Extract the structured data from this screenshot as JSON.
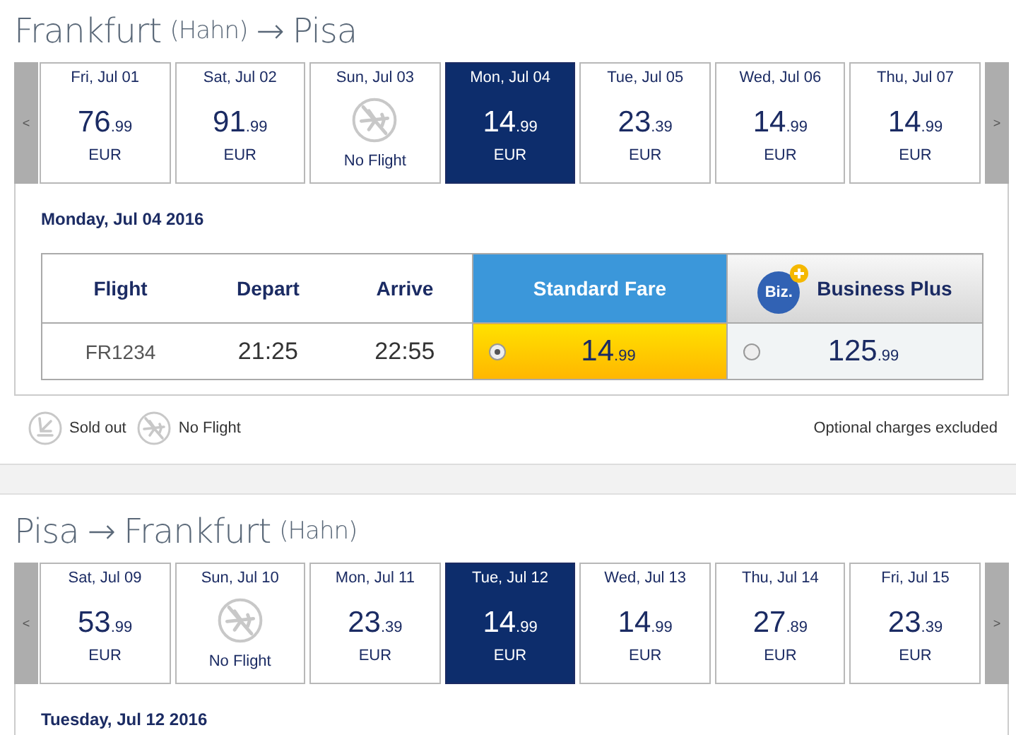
{
  "sections": [
    {
      "route": [
        {
          "text": "Frankfurt",
          "kind": "city"
        },
        {
          "text": "(Hahn)",
          "kind": "note"
        },
        {
          "text": "→",
          "kind": "city"
        },
        {
          "text": "Pisa",
          "kind": "city"
        }
      ],
      "prev": "<",
      "next": ">",
      "days": [
        {
          "day": "Fri, Jul 01",
          "kind": "fare",
          "price": "76",
          "cents": ".99",
          "currency": "EUR",
          "selected": false
        },
        {
          "day": "Sat, Jul 02",
          "kind": "fare",
          "price": "91",
          "cents": ".99",
          "currency": "EUR",
          "selected": false
        },
        {
          "day": "Sun, Jul 03",
          "kind": "no_flight",
          "label": "No Flight",
          "selected": false
        },
        {
          "day": "Mon, Jul 04",
          "kind": "fare",
          "price": "14",
          "cents": ".99",
          "currency": "EUR",
          "selected": true
        },
        {
          "day": "Tue, Jul 05",
          "kind": "fare",
          "price": "23",
          "cents": ".39",
          "currency": "EUR",
          "selected": false
        },
        {
          "day": "Wed, Jul 06",
          "kind": "fare",
          "price": "14",
          "cents": ".99",
          "currency": "EUR",
          "selected": false
        },
        {
          "day": "Thu, Jul 07",
          "kind": "fare",
          "price": "14",
          "cents": ".99",
          "currency": "EUR",
          "selected": false
        }
      ],
      "date_label": "Monday, Jul 04 2016",
      "table": {
        "columns": [
          "Flight",
          "Depart",
          "Arrive"
        ],
        "fare_columns": [
          {
            "label": "Standard Fare",
            "kind": "standard"
          },
          {
            "label": "Business Plus",
            "kind": "business",
            "badge": "Biz."
          }
        ],
        "rows": [
          {
            "flight": "FR1234",
            "depart": "21:25",
            "arrive": "22:55",
            "fares": [
              {
                "price": "14",
                "cents": ".99",
                "selected": true
              },
              {
                "price": "125",
                "cents": ".99",
                "selected": false
              }
            ]
          }
        ]
      },
      "legend": [
        {
          "kind": "sold_out",
          "label": "Sold out"
        },
        {
          "kind": "no_flight",
          "label": "No Flight"
        }
      ],
      "note": "Optional charges excluded"
    },
    {
      "route": [
        {
          "text": "Pisa",
          "kind": "city"
        },
        {
          "text": "→",
          "kind": "city"
        },
        {
          "text": "Frankfurt",
          "kind": "city"
        },
        {
          "text": "(Hahn)",
          "kind": "note"
        }
      ],
      "prev": "<",
      "next": ">",
      "days": [
        {
          "day": "Sat, Jul 09",
          "kind": "fare",
          "price": "53",
          "cents": ".99",
          "currency": "EUR",
          "selected": false
        },
        {
          "day": "Sun, Jul 10",
          "kind": "no_flight",
          "label": "No Flight",
          "selected": false
        },
        {
          "day": "Mon, Jul 11",
          "kind": "fare",
          "price": "23",
          "cents": ".39",
          "currency": "EUR",
          "selected": false
        },
        {
          "day": "Tue, Jul 12",
          "kind": "fare",
          "price": "14",
          "cents": ".99",
          "currency": "EUR",
          "selected": true
        },
        {
          "day": "Wed, Jul 13",
          "kind": "fare",
          "price": "14",
          "cents": ".99",
          "currency": "EUR",
          "selected": false
        },
        {
          "day": "Thu, Jul 14",
          "kind": "fare",
          "price": "27",
          "cents": ".89",
          "currency": "EUR",
          "selected": false
        },
        {
          "day": "Fri, Jul 15",
          "kind": "fare",
          "price": "23",
          "cents": ".39",
          "currency": "EUR",
          "selected": false
        }
      ],
      "date_label": "Tuesday, Jul 12 2016"
    }
  ]
}
